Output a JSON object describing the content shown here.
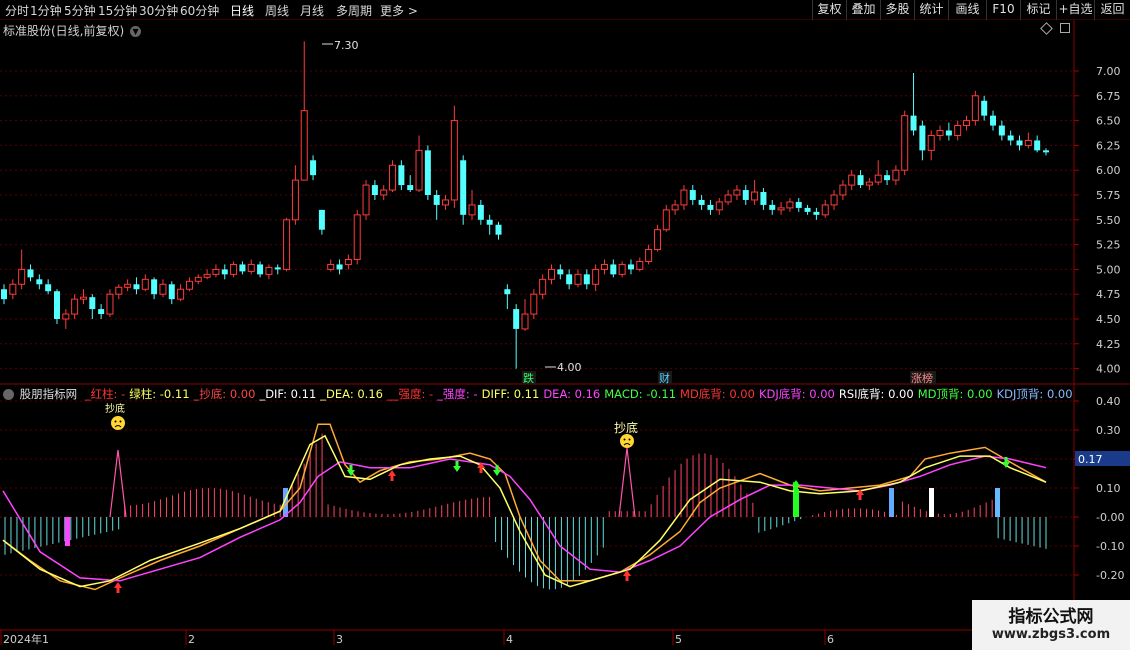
{
  "toolbar": {
    "periods": [
      "分时",
      "1分钟",
      "5分钟",
      "15分钟",
      "30分钟",
      "60分钟",
      "日线",
      "周线",
      "月线",
      "多周期",
      "更多 >"
    ],
    "active_period": "日线",
    "actions": [
      "复权",
      "叠加",
      "多股",
      "统计",
      "画线",
      "F10",
      "标记",
      "+自选",
      "返回"
    ]
  },
  "main_chart": {
    "title": "标准股份(日线,前复权)",
    "high_label": "7.30",
    "low_label": "4.00",
    "event_tags": [
      {
        "text": "跌",
        "color": "#33ff66"
      },
      {
        "text": "财",
        "color": "#55ccff"
      },
      {
        "text": "涨榜",
        "color": "#ff8888"
      }
    ],
    "price_axis": [
      "7.00",
      "6.75",
      "6.50",
      "6.25",
      "6.00",
      "5.75",
      "5.50",
      "5.25",
      "5.00",
      "4.75",
      "4.50",
      "4.25",
      "4.00"
    ]
  },
  "indicator": {
    "name": "股朋指标网",
    "fields": [
      {
        "label": "_红柱:",
        "value": "-",
        "color": "#ff3333"
      },
      {
        "label": "绿柱:",
        "value": "-0.11",
        "color": "#ffff66"
      },
      {
        "label": "_抄底:",
        "value": "0.00",
        "color": "#ff4444"
      },
      {
        "label": "_DIF:",
        "value": "0.11",
        "color": "#ffffff"
      },
      {
        "label": "_DEA:",
        "value": "0.16",
        "color": "#ffff66"
      },
      {
        "label": "__强度:",
        "value": "-",
        "color": "#ff3333"
      },
      {
        "label": "_强度:",
        "value": "-",
        "color": "#ff44ff"
      },
      {
        "label": "DIFF:",
        "value": "0.11",
        "color": "#ffff66"
      },
      {
        "label": "DEA:",
        "value": "0.16",
        "color": "#ff44ff"
      },
      {
        "label": "MACD:",
        "value": "-0.11",
        "color": "#44ff44"
      },
      {
        "label": "MD底背:",
        "value": "0.00",
        "color": "#ff3333"
      },
      {
        "label": "KDJ底背:",
        "value": "0.00",
        "color": "#ff44ff"
      },
      {
        "label": "RSI底背:",
        "value": "0.00",
        "color": "#ffffff"
      },
      {
        "label": "MD顶背:",
        "value": "0.00",
        "color": "#44ff44"
      },
      {
        "label": "KDJ顶背:",
        "value": "0.00",
        "color": "#88bbff"
      }
    ],
    "axis": [
      "0.40",
      "0.30",
      "0.20",
      "0.10",
      "-0.00",
      "-0.10",
      "-0.20"
    ],
    "current_value": "0.17",
    "signal_text_1": "抄底",
    "signal_text_2": "抄底"
  },
  "date_axis": [
    "2024年1",
    "2",
    "3",
    "4",
    "5",
    "6"
  ],
  "watermark": {
    "title": "指标公式网",
    "url": "www.zbgs3.com"
  }
}
